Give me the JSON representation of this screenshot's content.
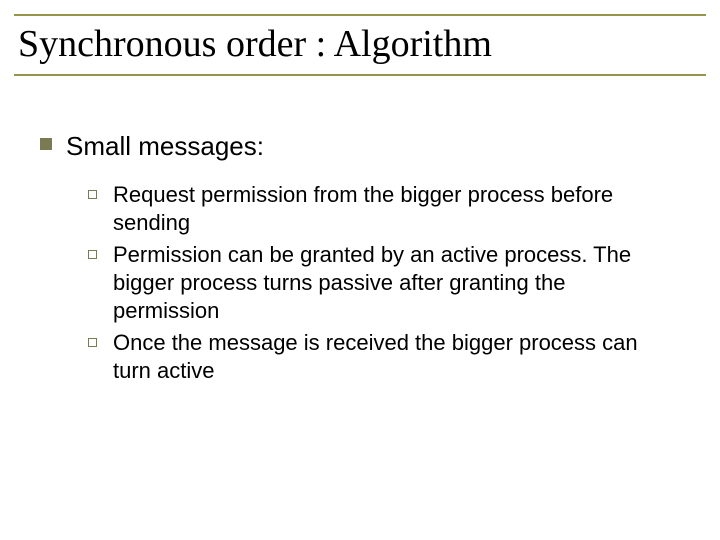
{
  "title": "Synchronous order : Algorithm",
  "heading": "Small messages:",
  "items": [
    "Request permission from the bigger process before sending",
    "Permission can be granted by an active process. The bigger process turns passive after granting the permission",
    "Once the message is received the bigger process can turn active"
  ]
}
